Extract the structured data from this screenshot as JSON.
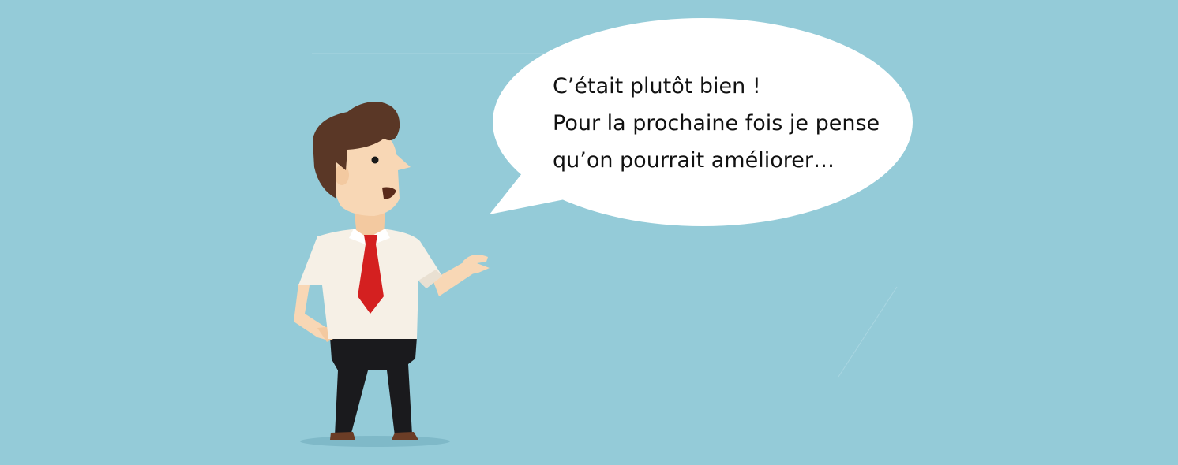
{
  "speech_bubble": {
    "lines": [
      "C’était plutôt bien !",
      "Pour la prochaine fois je pense",
      "qu’on pourrait améliorer…"
    ]
  },
  "colors": {
    "background": "#94cbd8",
    "bubble": "#ffffff",
    "hair": "#5a3726",
    "skin": "#f8d7b5",
    "shirt": "#f6f0e6",
    "tie": "#d42020",
    "trousers": "#1a1a1d",
    "shoes": "#6b3d26"
  },
  "icons": {
    "character": "businessman-illustration",
    "bubble": "speech-bubble"
  }
}
